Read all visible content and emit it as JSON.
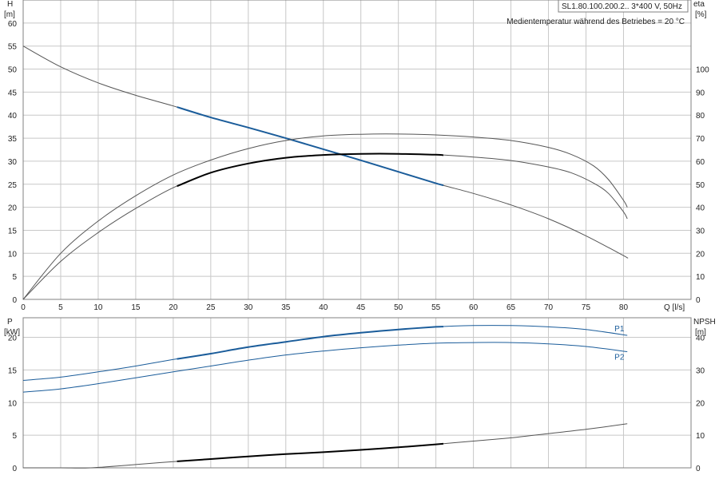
{
  "header": {
    "model": "SL1.80.100.200.2.. 3*400 V, 50Hz",
    "note": "Medientemperatur während des Betriebes = 20 °C"
  },
  "colors": {
    "grid": "#c8c8c8",
    "frame": "#808080",
    "curve": "#555555",
    "highlight": "#000000",
    "blue": "#1a5c9a"
  },
  "chart_data": [
    {
      "type": "line",
      "panel": "top",
      "xlabel": "Q [l/s]",
      "x_ticks": [
        0,
        5,
        10,
        15,
        20,
        25,
        30,
        35,
        40,
        45,
        50,
        55,
        60,
        65,
        70,
        75,
        80
      ],
      "xlim": [
        0,
        89
      ],
      "y_left": {
        "label_line1": "H",
        "label_line2": "[m]",
        "ylim": [
          0,
          65
        ],
        "ticks": [
          0,
          5,
          10,
          15,
          20,
          25,
          30,
          35,
          40,
          45,
          50,
          55,
          60
        ]
      },
      "y_right": {
        "label_line1": "eta",
        "label_line2": "[%]",
        "ylim": [
          0,
          130
        ],
        "ticks": [
          0,
          10,
          20,
          30,
          40,
          50,
          60,
          70,
          80,
          90,
          100
        ]
      },
      "grid": true,
      "series": [
        {
          "axis": "left",
          "color": "curve",
          "x": [
            0,
            5,
            10,
            15,
            20,
            25,
            30,
            35,
            40,
            45,
            50,
            55,
            60,
            65,
            70,
            75,
            80,
            80.5
          ],
          "y": [
            55,
            50.5,
            47,
            44.3,
            42,
            39.5,
            37.3,
            35,
            32.6,
            30.2,
            27.7,
            25.2,
            23,
            20.5,
            17.5,
            13.8,
            9.5,
            9
          ],
          "highlight": {
            "from": 20.5,
            "to": 56,
            "color": "blue"
          }
        },
        {
          "axis": "right",
          "color": "curve",
          "x": [
            0,
            5,
            10,
            15,
            20,
            25,
            30,
            35,
            40,
            45,
            50,
            55,
            60,
            65,
            70,
            73,
            76,
            78,
            80,
            80.5
          ],
          "y": [
            0,
            20,
            34,
            45,
            54,
            60.5,
            65.5,
            69,
            71,
            71.7,
            71.8,
            71.4,
            70.5,
            69,
            66,
            63,
            58,
            52,
            43,
            40
          ],
          "highlight": null
        },
        {
          "axis": "right",
          "color": "curve",
          "x": [
            0,
            5,
            10,
            15,
            20,
            25,
            30,
            35,
            40,
            45,
            50,
            55,
            60,
            65,
            70,
            73,
            76,
            78,
            80,
            80.5
          ],
          "y": [
            0,
            16.5,
            29,
            39.5,
            48.5,
            55,
            59,
            61.5,
            62.7,
            63.2,
            63.2,
            62.8,
            61.8,
            60.3,
            57.5,
            55,
            50.5,
            46,
            38,
            35
          ],
          "highlight": {
            "from": 20.5,
            "to": 56,
            "color": "highlight"
          }
        }
      ]
    },
    {
      "type": "line",
      "panel": "bottom",
      "x_ticks": [
        0,
        5,
        10,
        15,
        20,
        25,
        30,
        35,
        40,
        45,
        50,
        55,
        60,
        65,
        70,
        75,
        80
      ],
      "xlim": [
        0,
        89
      ],
      "y_left": {
        "label_line1": "P",
        "label_line2": "[kW]",
        "ylim": [
          0,
          23
        ],
        "ticks": [
          0,
          5,
          10,
          15,
          20
        ]
      },
      "y_right": {
        "label_line1": "NPSH",
        "label_line2": "[m]",
        "ylim": [
          0,
          46
        ],
        "ticks": [
          0,
          10,
          20,
          30,
          40
        ]
      },
      "grid": true,
      "series": [
        {
          "name": "P1",
          "axis": "left",
          "color": "blue",
          "x": [
            0,
            5,
            10,
            15,
            20,
            25,
            30,
            35,
            40,
            45,
            50,
            55,
            60,
            65,
            70,
            75,
            80.5
          ],
          "y": [
            13.4,
            13.9,
            14.7,
            15.6,
            16.6,
            17.5,
            18.5,
            19.3,
            20.1,
            20.7,
            21.2,
            21.6,
            21.8,
            21.8,
            21.6,
            21.2,
            20.3
          ],
          "highlight": {
            "from": 20.5,
            "to": 56,
            "color": "blue"
          }
        },
        {
          "name": "P2",
          "axis": "left",
          "color": "blue",
          "x": [
            0,
            5,
            10,
            15,
            20,
            25,
            30,
            35,
            40,
            45,
            50,
            55,
            60,
            65,
            70,
            75,
            80.5
          ],
          "y": [
            11.6,
            12.1,
            12.9,
            13.8,
            14.7,
            15.6,
            16.5,
            17.3,
            17.9,
            18.4,
            18.8,
            19.1,
            19.2,
            19.2,
            19,
            18.6,
            17.8
          ],
          "highlight": null
        },
        {
          "name": "",
          "axis": "right",
          "color": "curve",
          "x": [
            0,
            5,
            9,
            15,
            20,
            25,
            30,
            35,
            40,
            45,
            50,
            55,
            60,
            65,
            70,
            75,
            80.5
          ],
          "y": [
            0,
            0,
            0,
            1,
            1.9,
            2.7,
            3.5,
            4.2,
            4.8,
            5.5,
            6.3,
            7.2,
            8.2,
            9.2,
            10.5,
            11.8,
            13.5
          ],
          "highlight": {
            "from": 20.5,
            "to": 56,
            "color": "highlight"
          }
        }
      ]
    }
  ]
}
